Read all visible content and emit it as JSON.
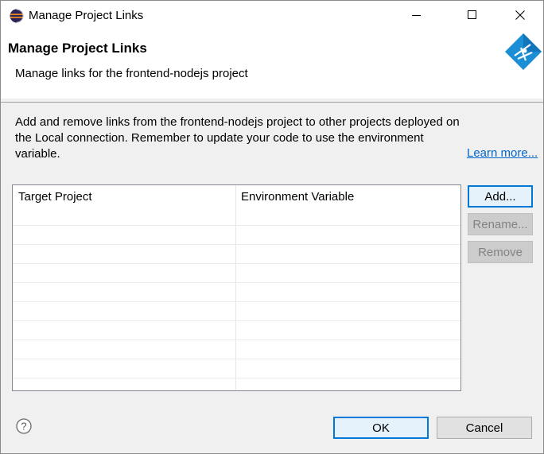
{
  "window": {
    "title": "Manage Project Links"
  },
  "header": {
    "title": "Manage Project Links",
    "description": "Manage links for the frontend-nodejs project"
  },
  "body": {
    "description": "Add and remove links from the frontend-nodejs project to other projects deployed on the Local connection. Remember to update your code to use the environment variable.",
    "learn_more": "Learn more..."
  },
  "table": {
    "columns": [
      "Target Project",
      "Environment Variable"
    ],
    "rows": []
  },
  "side_buttons": {
    "add": "Add...",
    "rename": "Rename...",
    "remove": "Remove"
  },
  "footer": {
    "ok": "OK",
    "cancel": "Cancel"
  },
  "icons": {
    "app": "eclipse-icon",
    "minimize": "minimize-icon",
    "maximize": "maximize-icon",
    "close": "close-icon",
    "wizard": "wizard-banner-icon",
    "help": "help-icon"
  },
  "colors": {
    "accent": "#0078d7",
    "link": "#0066cc",
    "logo": "#1a8fd6"
  }
}
